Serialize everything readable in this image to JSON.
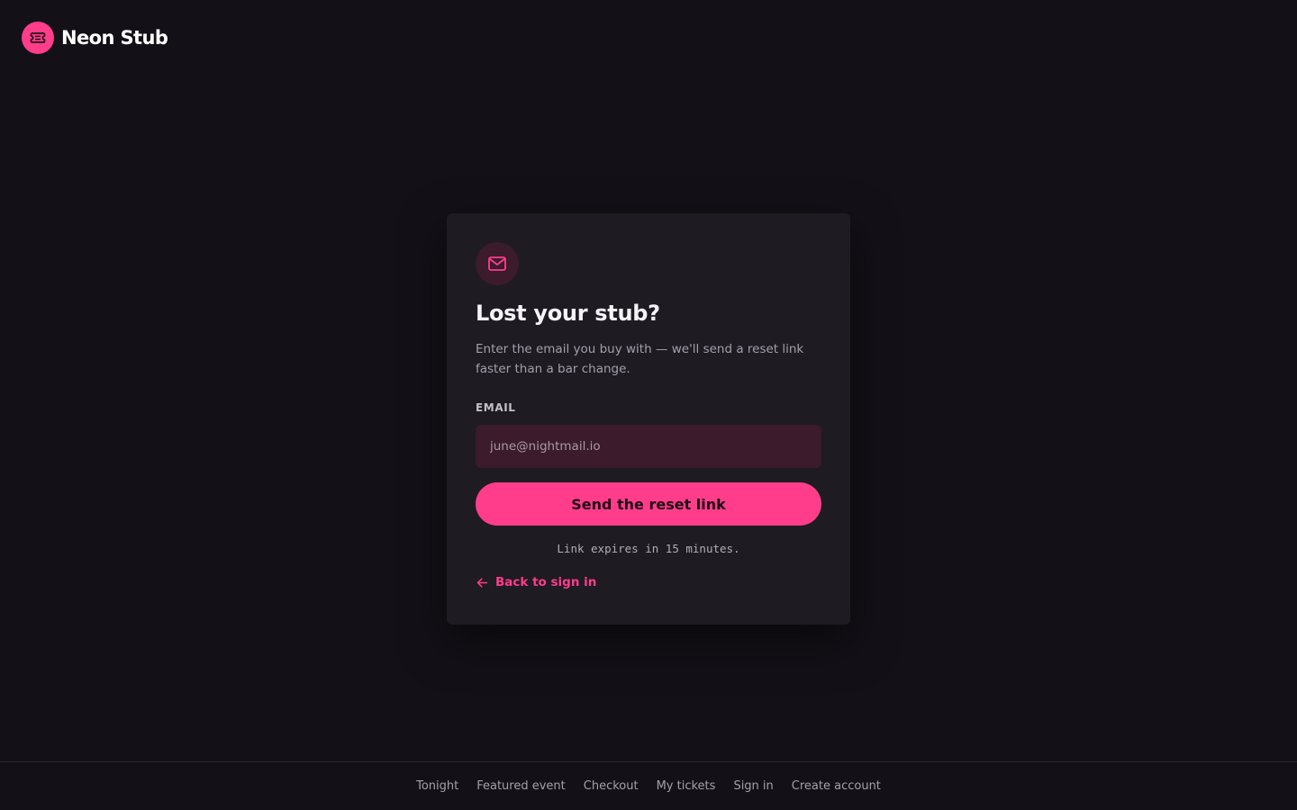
{
  "header": {
    "brand_name": "Neon Stub",
    "brand_icon": "ticket-icon"
  },
  "card": {
    "icon": "mail-icon",
    "title": "Lost your stub?",
    "subtitle": "Enter the email you buy with — we'll send a reset link faster than a bar change.",
    "email_label": "EMAIL",
    "email_placeholder": "june@nightmail.io",
    "email_value": "",
    "submit_label": "Send the reset link",
    "expiry_note": "Link expires in 15 minutes.",
    "back_label": "Back to sign in",
    "back_icon": "arrow-left-icon"
  },
  "footer": {
    "links": [
      "Tonight",
      "Featured event",
      "Checkout",
      "My tickets",
      "Sign in",
      "Create account"
    ]
  },
  "colors": {
    "background": "#131117",
    "card": "#1e1b23",
    "accent": "#ff3d8b",
    "input_bg": "#3b1b2c"
  }
}
